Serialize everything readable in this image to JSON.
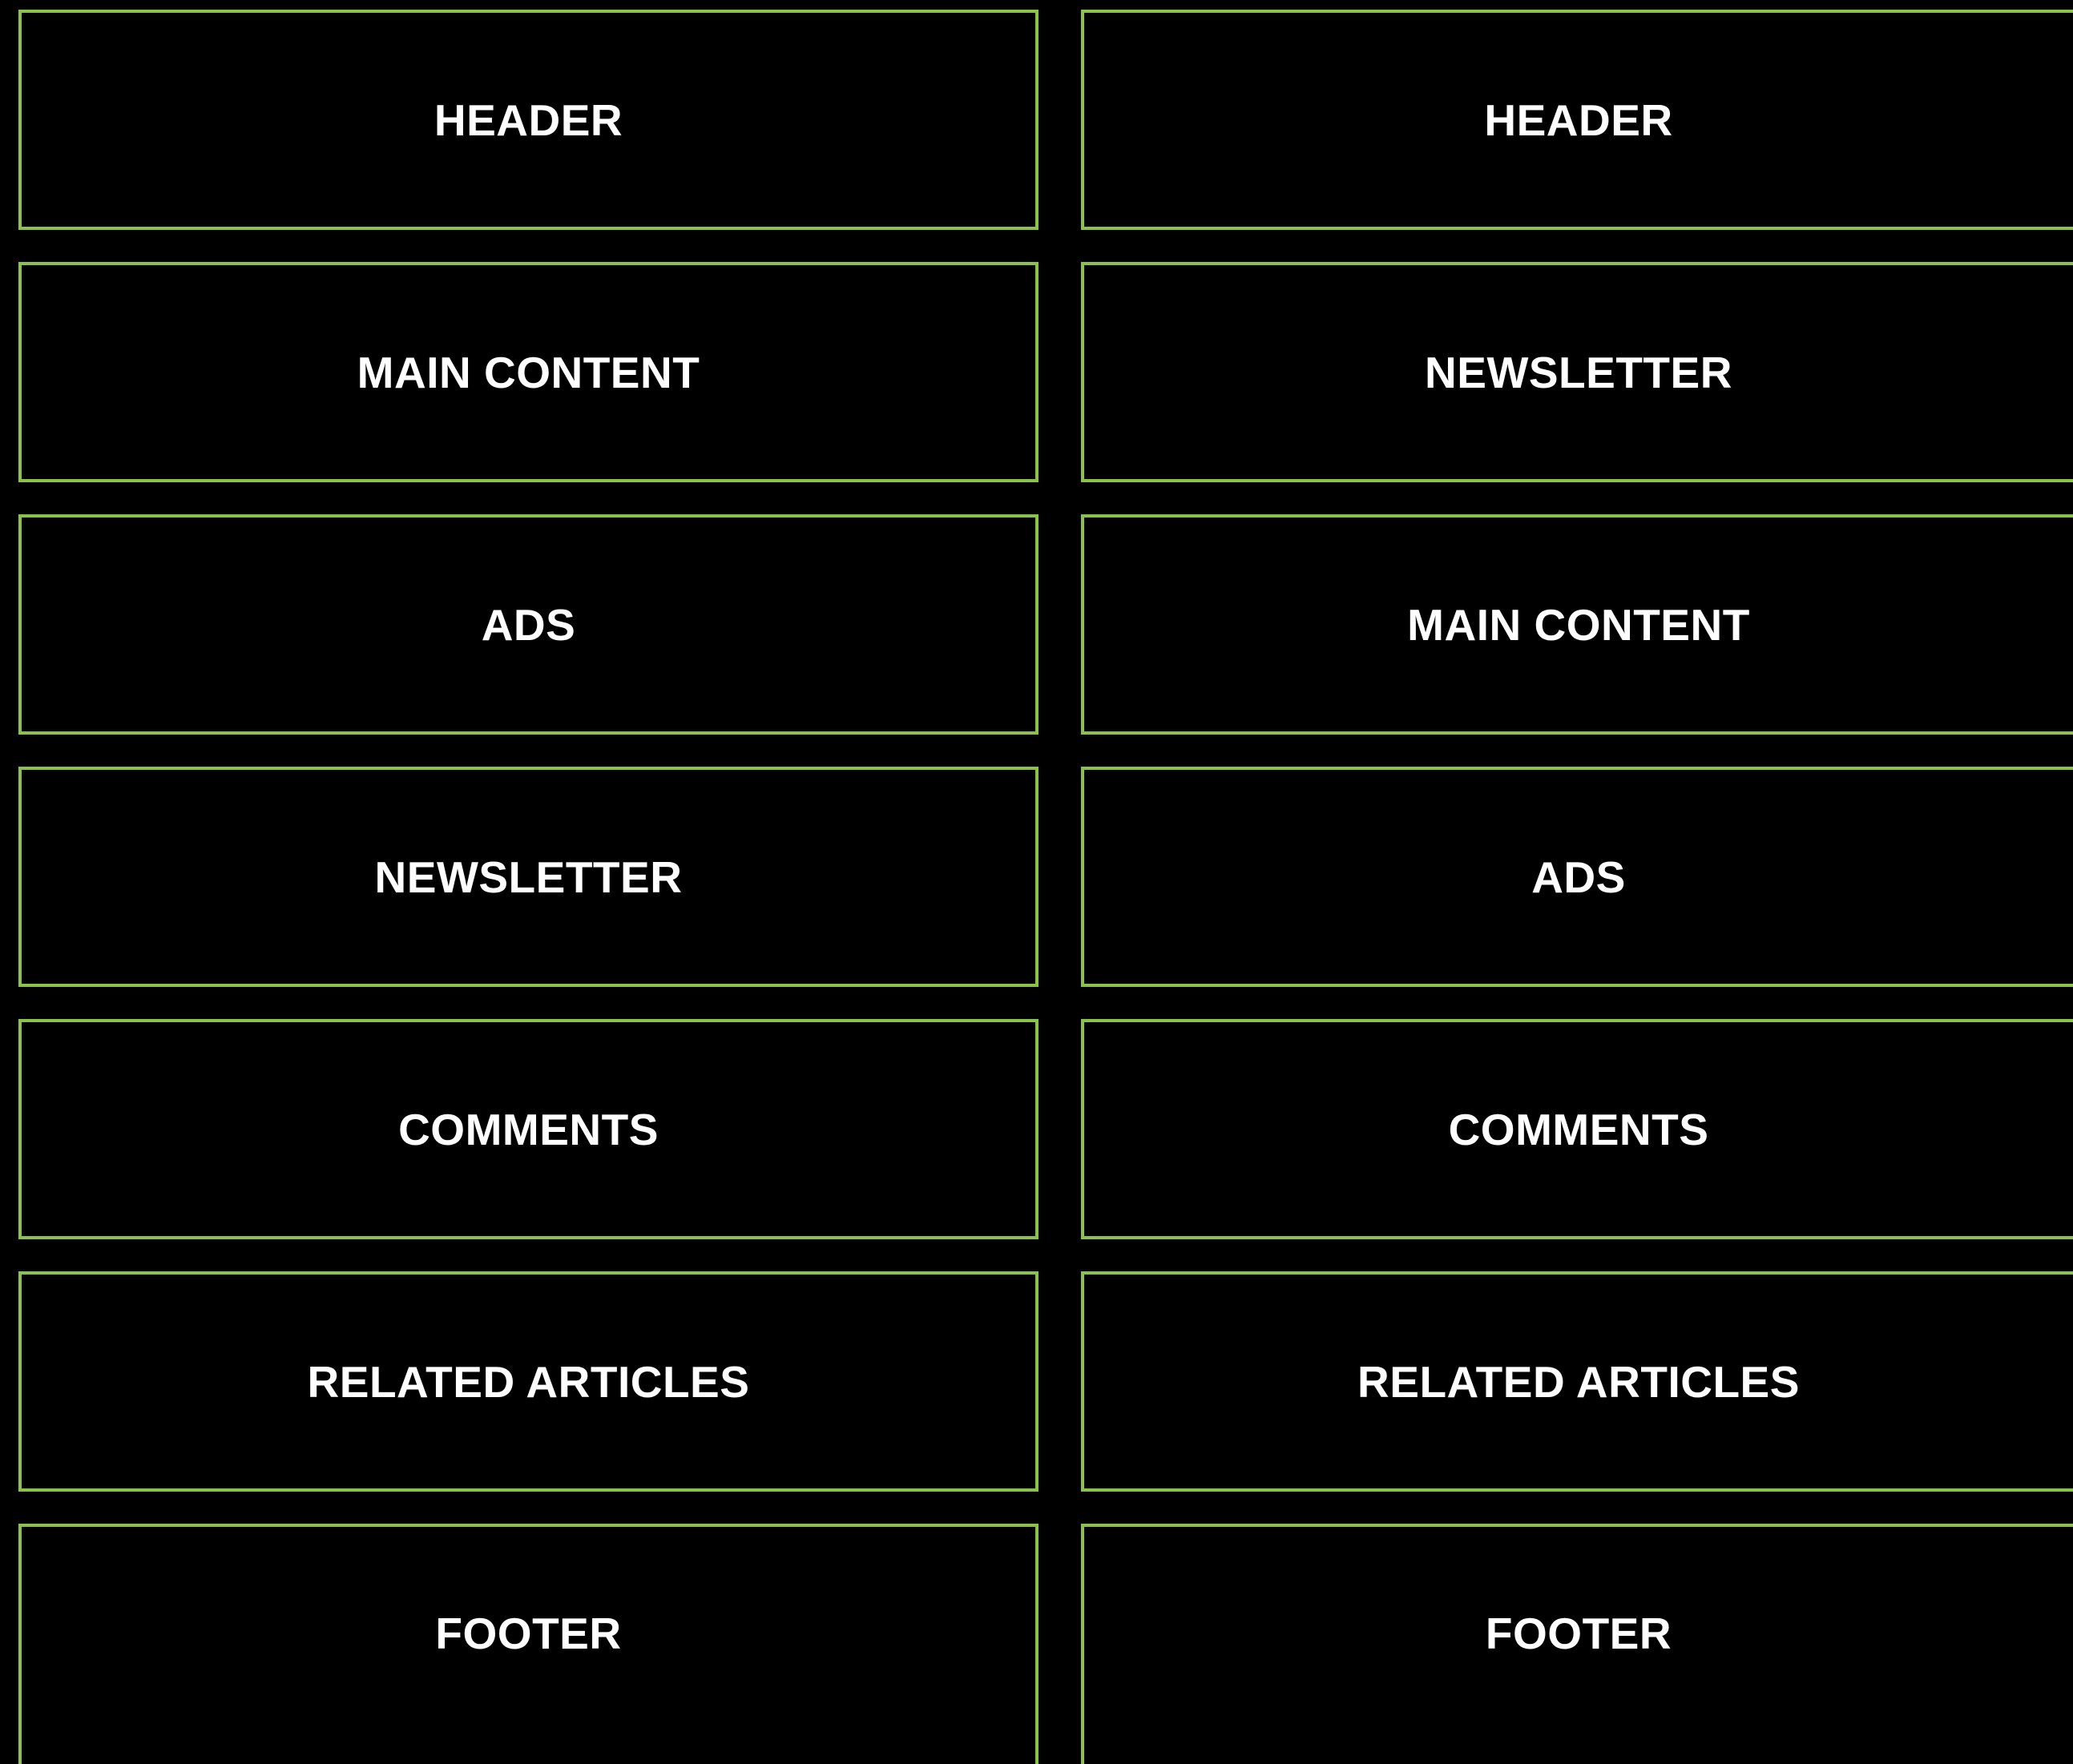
{
  "colors": {
    "background": "#000000",
    "block_border": "#8bc34a",
    "label_text": "#ffffff"
  },
  "left_column": {
    "blocks": [
      {
        "label": "HEADER"
      },
      {
        "label": "MAIN CONTENT"
      },
      {
        "label": "ADS"
      },
      {
        "label": "NEWSLETTER"
      },
      {
        "label": "COMMENTS"
      },
      {
        "label": "RELATED ARTICLES"
      },
      {
        "label": "FOOTER"
      }
    ]
  },
  "right_column": {
    "blocks": [
      {
        "label": "HEADER"
      },
      {
        "label": "NEWSLETTER"
      },
      {
        "label": "MAIN CONTENT"
      },
      {
        "label": "ADS"
      },
      {
        "label": "COMMENTS"
      },
      {
        "label": "RELATED ARTICLES"
      },
      {
        "label": "FOOTER"
      }
    ]
  }
}
